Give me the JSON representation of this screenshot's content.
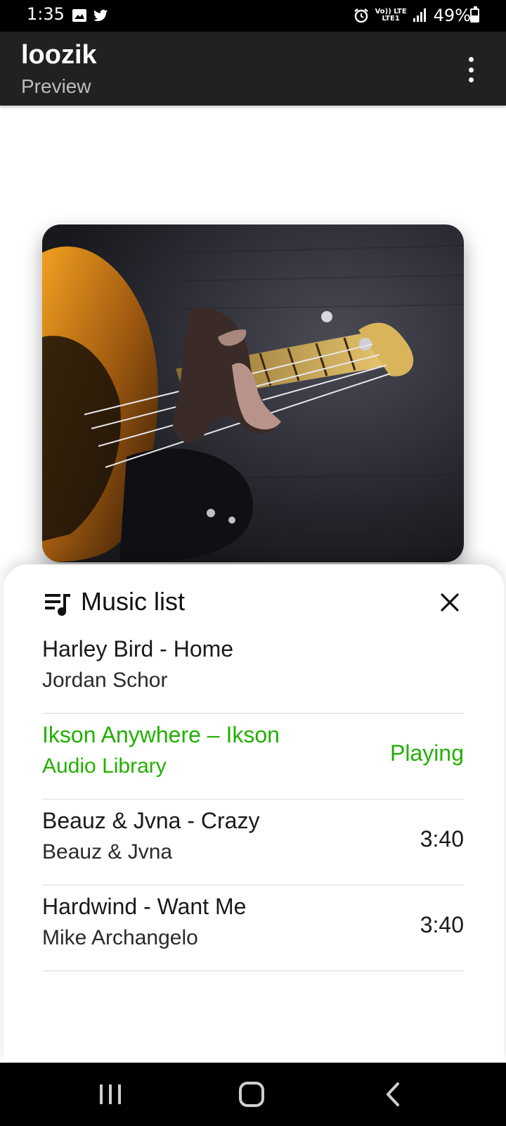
{
  "status_bar": {
    "time": "1:35",
    "network_label": "Vo)) LTE",
    "network_sub": "LTE1",
    "battery": "49%",
    "battery_level": 0.49,
    "icons": [
      "image-icon",
      "twitter-icon",
      "alarm-icon",
      "signal-icon",
      "battery-icon"
    ]
  },
  "app_bar": {
    "title": "loozik",
    "subtitle": "Preview",
    "menu_icon": "more-vert-icon"
  },
  "sheet": {
    "title": "Music list",
    "header_icon": "playlist-music-icon",
    "close_icon": "close-icon"
  },
  "tracks": [
    {
      "title": "Harley Bird - Home",
      "artist": "Jordan Schor",
      "meta": ""
    },
    {
      "title": "Ikson Anywhere – Ikson",
      "artist": "Audio Library",
      "meta": "Playing"
    },
    {
      "title": "Beauz & Jvna - Crazy",
      "artist": "Beauz & Jvna",
      "meta": "3:40"
    },
    {
      "title": "Hardwind - Want Me",
      "artist": "Mike Archangelo",
      "meta": "3:40"
    }
  ],
  "colors": {
    "playing": "#22b000",
    "app_bar": "#212121",
    "system_bar": "#000000"
  },
  "nav_bar": {
    "icons": [
      "recent-apps-icon",
      "home-icon",
      "back-icon"
    ]
  }
}
